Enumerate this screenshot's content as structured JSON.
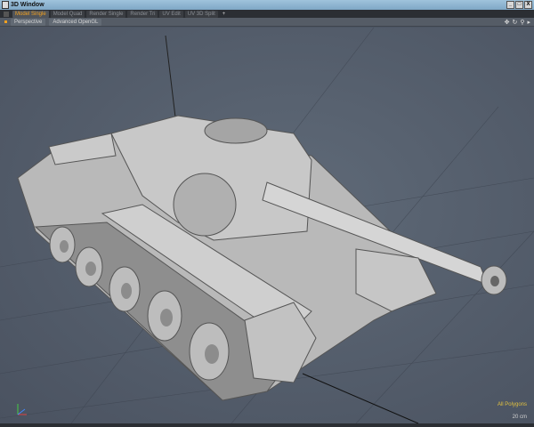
{
  "window": {
    "title": "3D Window",
    "buttons": [
      "_",
      "□",
      "X"
    ]
  },
  "tabs": [
    {
      "label": "Model Single",
      "active": true
    },
    {
      "label": "Model Quad"
    },
    {
      "label": "Render Single"
    },
    {
      "label": "Render Tri"
    },
    {
      "label": "UV Edit"
    },
    {
      "label": "UV 3D Split"
    },
    {
      "label": "+"
    }
  ],
  "toolbar": {
    "view": "Perspective",
    "shading": "Advanced OpenGL"
  },
  "nav_icons": [
    "move-icon",
    "rotate-icon",
    "zoom-icon",
    "menu-icon"
  ],
  "viewport": {
    "selection_mode": "All Polygons",
    "grid_scale": "20 cm"
  },
  "colors": {
    "accent": "#f0a020",
    "background": "#4c5563"
  }
}
